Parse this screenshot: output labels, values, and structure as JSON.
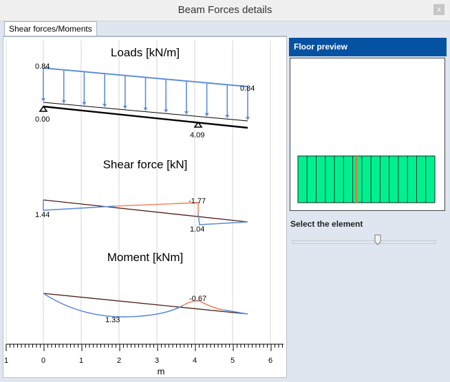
{
  "window": {
    "title": "Beam Forces details",
    "close_label": "x"
  },
  "tabs": [
    {
      "label": "Shear forces/Moments"
    }
  ],
  "right_panel": {
    "preview_title": "Floor preview",
    "select_label": "Select the element",
    "slider": {
      "value_fraction": 0.6
    }
  },
  "colors": {
    "accent": "#0652a2",
    "load_arrow": "#5b8ed8",
    "positive": "#5b8ed8",
    "negative": "#f4845f",
    "reference": "#4d1a10",
    "floor": "#00f090",
    "selected": "#e07a2e"
  },
  "chart_data": {
    "type": "line",
    "xlabel": "m",
    "xlim": [
      -1,
      6.5
    ],
    "x_ticks": [
      "1",
      "0",
      "1",
      "2",
      "3",
      "4",
      "5",
      "6"
    ],
    "grid": true,
    "subcharts": [
      {
        "title": "Loads [kN/m]",
        "load_start": 0.84,
        "load_end": 0.84,
        "load_start_label": "0.84",
        "load_end_label": "0.84",
        "beam_start": 0.0,
        "beam_end": 5.4,
        "supports": [
          {
            "x": 0.0,
            "label": "0.00"
          },
          {
            "x": 4.09,
            "label": "4.09"
          }
        ]
      },
      {
        "title": "Shear force [kN]",
        "labels": [
          {
            "x": 0.0,
            "text": "1.44"
          },
          {
            "x": 4.09,
            "text": "-1.77"
          },
          {
            "x": 4.09,
            "text": "1.04"
          }
        ],
        "values": {
          "left": 1.44,
          "support_neg": -1.77,
          "support_pos": 1.04
        }
      },
      {
        "title": "Moment [kNm]",
        "labels": [
          {
            "x": 1.9,
            "text": "1.33"
          },
          {
            "x": 4.09,
            "text": "-0.67"
          }
        ],
        "values": {
          "span_max": 1.33,
          "support": -0.67
        }
      }
    ]
  }
}
